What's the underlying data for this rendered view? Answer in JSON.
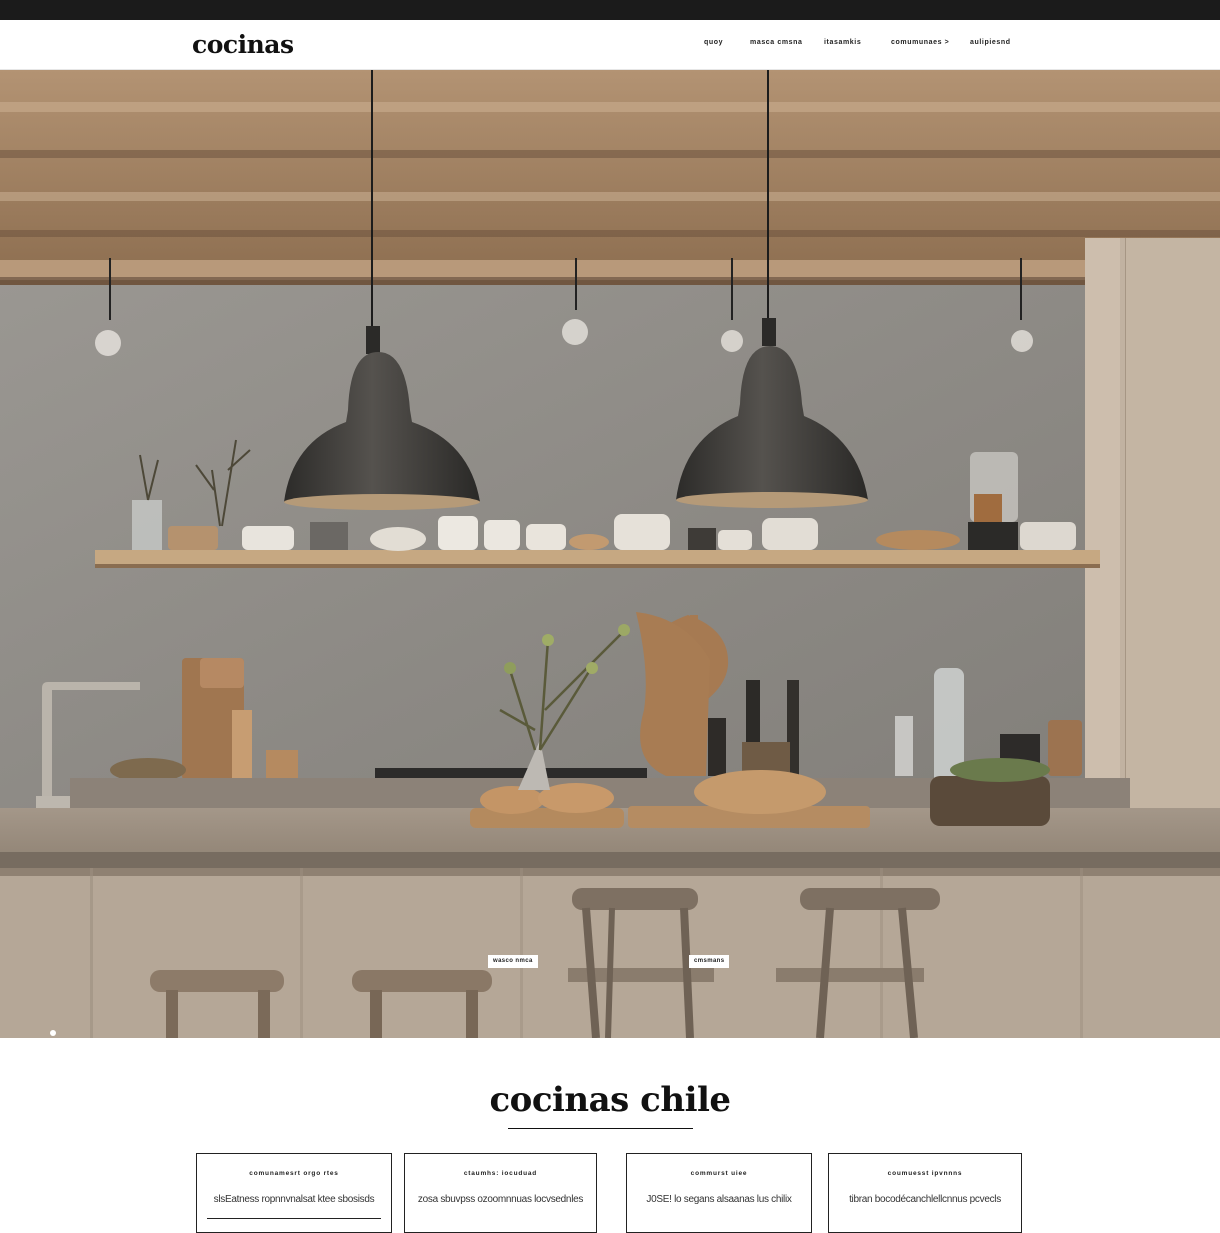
{
  "header": {
    "logo": "cocinas",
    "nav": [
      "quoy",
      "masca cmsna",
      "itasamkis",
      "comumunaes >",
      "aulipiesnd"
    ]
  },
  "hero": {
    "tags": [
      "wasco nmca",
      "cmsmans"
    ]
  },
  "section": {
    "title": "cocinas chile"
  },
  "cards": [
    {
      "title": "comunamesrt  orgo rtes",
      "desc": "slsEatness ropnnvnalsat ktee sbosisds"
    },
    {
      "title": "ctaumhs:   iocuduad",
      "desc": "zosa sbuvpss ozoomnnuas locvsednles"
    },
    {
      "title": "commurst  uiee",
      "desc": "J0SE! lo segans  alsaanas lus chilix"
    },
    {
      "title": "coumuesst   ipvnnns",
      "desc": "tibran bocodécanchlellcnnus pcvecls"
    }
  ],
  "colors": {
    "topbar": "#1b1b1b",
    "wood": "#a98b6c",
    "concrete": "#8f8b86",
    "lamp": "#3d3b38"
  }
}
